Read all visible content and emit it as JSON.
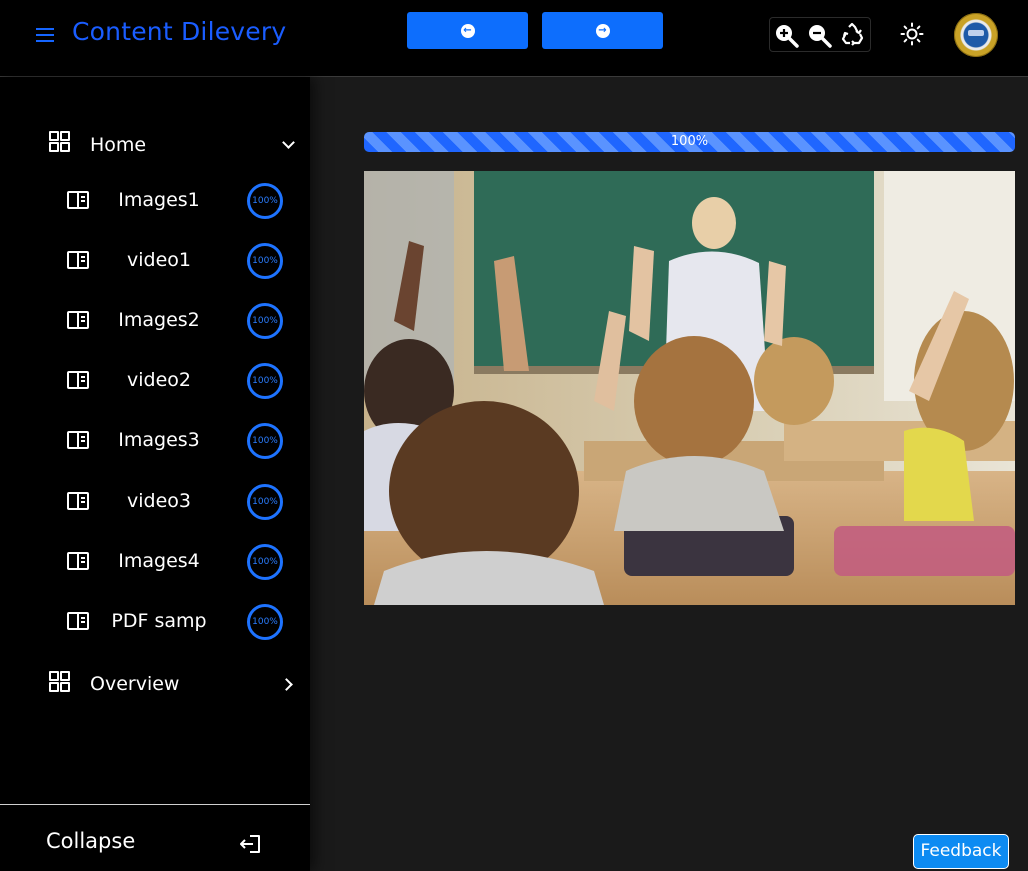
{
  "header": {
    "title": "Content Dilevery",
    "prev_icon": "arrow-left-icon",
    "next_icon": "arrow-right-icon",
    "zoom_icons": [
      "zoom-in-icon",
      "zoom-out-icon",
      "recycle-icon"
    ],
    "theme_icon": "sun-icon",
    "accent_color": "#0d6efd"
  },
  "sidebar": {
    "sections": [
      {
        "label": "Home",
        "expanded": true
      },
      {
        "label": "Overview",
        "expanded": false
      }
    ],
    "items": [
      {
        "label": "Images1",
        "progress": "100%"
      },
      {
        "label": "video1",
        "progress": "100%"
      },
      {
        "label": "Images2",
        "progress": "100%"
      },
      {
        "label": "video2",
        "progress": "100%"
      },
      {
        "label": "Images3",
        "progress": "100%"
      },
      {
        "label": "video3",
        "progress": "100%"
      },
      {
        "label": "Images4",
        "progress": "100%"
      },
      {
        "label": "PDF samp",
        "progress": "100%"
      }
    ],
    "collapse_label": "Collapse"
  },
  "main": {
    "progress": {
      "value": 100,
      "label": "100%"
    },
    "image_description_icon": "classroom-photo"
  },
  "feedback_label": "Feedback"
}
